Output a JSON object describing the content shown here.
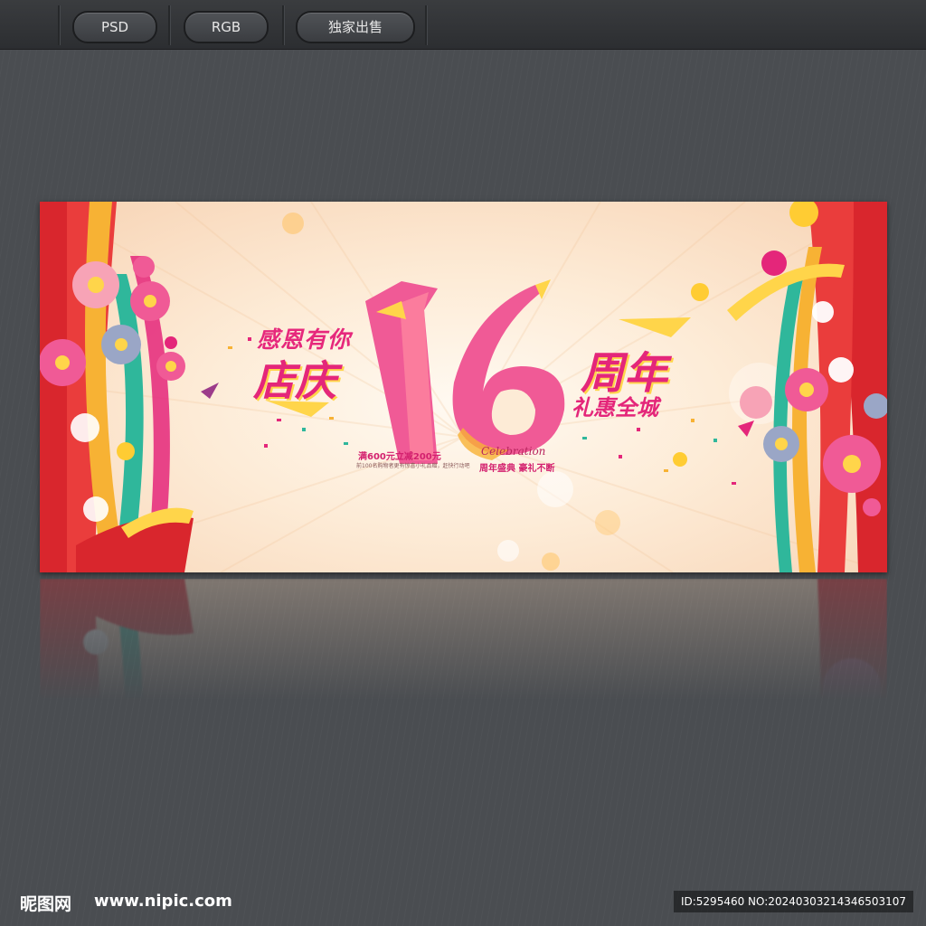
{
  "toolbar": {
    "format_label": "PSD",
    "color_mode_label": "RGB",
    "exclusive_label": "独家出售"
  },
  "banner": {
    "thanks_text": "感恩有你",
    "store_text": "店庆",
    "number_text": "16",
    "anniversary_text": "周年",
    "gift_text": "礼惠全城",
    "promo_text": "满600元立减200元",
    "promo_small_text": "前100名购物者更有惊喜小礼品赠，赶快行动吧",
    "celebration_text": "Celebration",
    "celebration_sub_text": "周年盛典 豪礼不断",
    "colors": {
      "primary_pink": "#e4267a",
      "accent_yellow": "#ffd54a",
      "curtain_red": "#d9262d",
      "ribbon_teal": "#2fb79b"
    }
  },
  "footer": {
    "site_logo": "昵图网",
    "site_url": "www.nipic.com",
    "image_id": "ID:5295460 NO:20240303214346503107"
  }
}
